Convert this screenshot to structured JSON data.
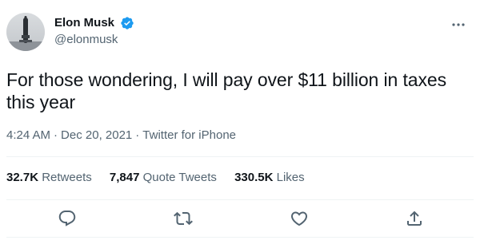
{
  "author": {
    "display_name": "Elon Musk",
    "handle": "@elonmusk",
    "verified": true
  },
  "tweet": {
    "text": "For those wondering, I will pay over $11 billion in taxes this year",
    "time": "4:24 AM",
    "separator": "·",
    "date": "Dec 20, 2021",
    "source": "Twitter for iPhone"
  },
  "stats": {
    "retweets": {
      "count": "32.7K",
      "label": "Retweets"
    },
    "quote_tweets": {
      "count": "7,847",
      "label": "Quote Tweets"
    },
    "likes": {
      "count": "330.5K",
      "label": "Likes"
    }
  },
  "icons": {
    "verified": "verified-badge-icon",
    "more": "more-options-icon",
    "reply": "reply-icon",
    "retweet": "retweet-icon",
    "like": "heart-icon",
    "share": "share-icon"
  },
  "colors": {
    "verified": "#1d9bf0",
    "secondary_text": "#536471",
    "primary_text": "#0f1419",
    "divider": "#eff3f4"
  }
}
